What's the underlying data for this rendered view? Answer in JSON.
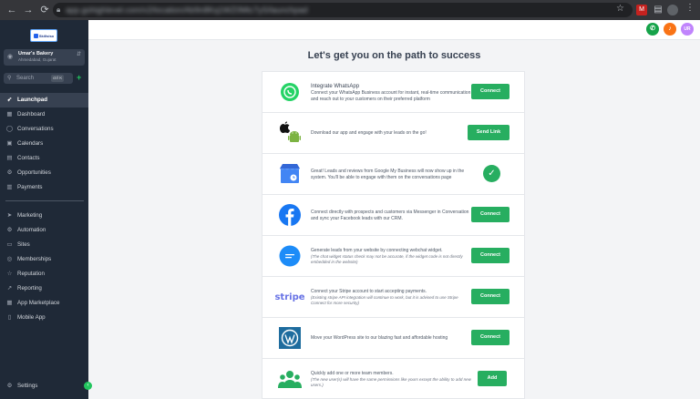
{
  "browser": {
    "back": "←",
    "forward": "→",
    "reload": "⟳",
    "url": "app.gohighlevel.com/v2/location/Ab9n8Kq1WZ0Mtc7yS/launchpad",
    "star": "☆",
    "ext1": "M",
    "ext2": "▤",
    "ext3": "⋮",
    "menu": "⋮"
  },
  "sidebar": {
    "logo_text": "Skillsiso",
    "account": {
      "name": "Umar's Bakery",
      "location": "Ahmedabad, Gujarat",
      "chevron": "⇵"
    },
    "search": {
      "placeholder": "Search",
      "shortcut": "ctrl K"
    },
    "add": "+",
    "items_top": [
      {
        "label": "Launchpad",
        "icon": "rocket-icon",
        "glyph": "➶",
        "active": true
      },
      {
        "label": "Dashboard",
        "icon": "dashboard-icon",
        "glyph": "▦"
      },
      {
        "label": "Conversations",
        "icon": "chat-icon",
        "glyph": "◯"
      },
      {
        "label": "Calendars",
        "icon": "calendar-icon",
        "glyph": "▣"
      },
      {
        "label": "Contacts",
        "icon": "contacts-icon",
        "glyph": "▤"
      },
      {
        "label": "Opportunities",
        "icon": "funnel-icon",
        "glyph": "⚙"
      },
      {
        "label": "Payments",
        "icon": "payments-icon",
        "glyph": "▥"
      }
    ],
    "items_bottom": [
      {
        "label": "Marketing",
        "icon": "megaphone-icon",
        "glyph": "➤"
      },
      {
        "label": "Automation",
        "icon": "automation-icon",
        "glyph": "⚙"
      },
      {
        "label": "Sites",
        "icon": "globe-icon",
        "glyph": "▭"
      },
      {
        "label": "Memberships",
        "icon": "memberships-icon",
        "glyph": "◎"
      },
      {
        "label": "Reputation",
        "icon": "star-icon",
        "glyph": "☆"
      },
      {
        "label": "Reporting",
        "icon": "chart-icon",
        "glyph": "↗"
      },
      {
        "label": "App Marketplace",
        "icon": "marketplace-icon",
        "glyph": "▦"
      },
      {
        "label": "Mobile App",
        "icon": "mobile-icon",
        "glyph": "▯"
      }
    ],
    "settings": {
      "label": "Settings",
      "glyph": "⚙"
    },
    "collapse": "‹"
  },
  "header": {
    "btn_call": "✆",
    "btn_notify": "♪",
    "btn_avatar": "UR"
  },
  "page": {
    "title": "Let's get you on the path to success"
  },
  "cards": [
    {
      "title": "Integrate WhatsApp",
      "desc": "Connect your WhatsApp Business account for instant, real-time communication and reach out to your customers on their preferred platform",
      "button": "Connect"
    },
    {
      "desc": "Download our app and engage with your leads on the go!",
      "button": "Send Link"
    },
    {
      "desc": "Great! Leads and reviews from Google My Business will now show up in the system. You'll be able to engage with them on the conversations page",
      "check": "✓"
    },
    {
      "desc": "Connect directly with prospects and customers via Messenger in Conversation and sync your Facebook leads with our CRM.",
      "button": "Connect"
    },
    {
      "desc": "Generate leads from your website by connecting webchat widget.",
      "note": "(The chat widget status check may not be accurate, if the widget code is not directly embedded in the website)",
      "button": "Connect"
    },
    {
      "desc": "Connect your Stripe account to start accepting payments.",
      "note": "(Existing stripe API integration will continue to work, but it is advised to use Stripe Connect for more security)",
      "button": "Connect",
      "logo": "stripe"
    },
    {
      "desc": "Move your WordPress site to our blazing fast and affordable hosting",
      "button": "Connect"
    },
    {
      "desc": "Quickly add one or more team members.",
      "note": "(The new user(s) will have the same permissions like yours except the ability to add new users.)",
      "button": "Add"
    }
  ],
  "colors": {
    "sidebar_bg": "#1f2937",
    "accent_green": "#27ae60",
    "page_bg": "#f3f4f6"
  }
}
